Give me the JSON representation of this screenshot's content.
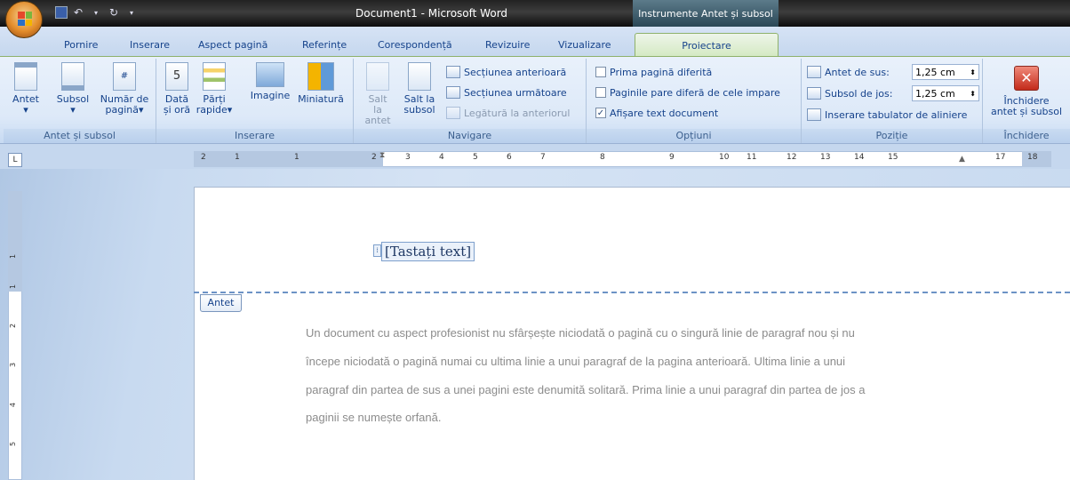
{
  "title": {
    "document": "Document1 - Microsoft Word",
    "context_tab": "Instrumente Antet și subsol"
  },
  "tabs": [
    "Pornire",
    "Inserare",
    "Aspect pagină",
    "Referințe",
    "Corespondență",
    "Revizuire",
    "Vizualizare",
    "Proiectare"
  ],
  "active_tab": "Proiectare",
  "groups": {
    "antet_subsol": {
      "label": "Antet și subsol",
      "antet": "Antet",
      "subsol": "Subsol",
      "numar_1": "Număr de",
      "numar_2": "pagină"
    },
    "inserare": {
      "label": "Inserare",
      "data_1": "Dată",
      "data_2": "și oră",
      "parti_1": "Părți",
      "parti_2": "rapide",
      "imagine": "Imagine",
      "miniatura": "Miniatură"
    },
    "navigare": {
      "label": "Navigare",
      "salt_antet_1": "Salt la",
      "salt_antet_2": "antet",
      "salt_subsol_1": "Salt la",
      "salt_subsol_2": "subsol",
      "sect_ant": "Secțiunea anterioară",
      "sect_urm": "Secțiunea următoare",
      "legatura": "Legătură la anteriorul"
    },
    "optiuni": {
      "label": "Opțiuni",
      "prima": "Prima pagină diferită",
      "pare": "Paginile pare diferă de cele impare",
      "afisare": "Afișare text document"
    },
    "pozitie": {
      "label": "Poziție",
      "antet_sus": "Antet de sus:",
      "antet_sus_val": "1,25 cm",
      "subsol_jos": "Subsol de jos:",
      "subsol_jos_val": "1,25 cm",
      "tabulator": "Inserare tabulator de aliniere"
    },
    "inchidere": {
      "label": "Închidere",
      "btn_1": "Închidere",
      "btn_2": "antet și subsol"
    }
  },
  "ruler": {
    "corner": "L",
    "marks": [
      "2",
      "1",
      "1",
      "2",
      "3",
      "4",
      "5",
      "6",
      "7",
      "8",
      "9",
      "10",
      "11",
      "12",
      "13",
      "14",
      "15",
      "17",
      "18"
    ],
    "vmarks": [
      "1",
      "1",
      "2",
      "3",
      "4",
      "5"
    ]
  },
  "document": {
    "header_placeholder": "[Tastați text]",
    "header_label": "Antet",
    "body": [
      "Un document cu aspect profesionist nu sfârșește niciodată o pagină cu o singură linie de paragraf nou și nu",
      "începe niciodată o pagină numai cu ultima linie a unui paragraf de la pagina anterioară. Ultima linie a unui",
      "paragraf din partea de sus a unei pagini este denumită solitară. Prima linie a unui paragraf din partea de jos a",
      "paginii se numește orfană."
    ]
  }
}
